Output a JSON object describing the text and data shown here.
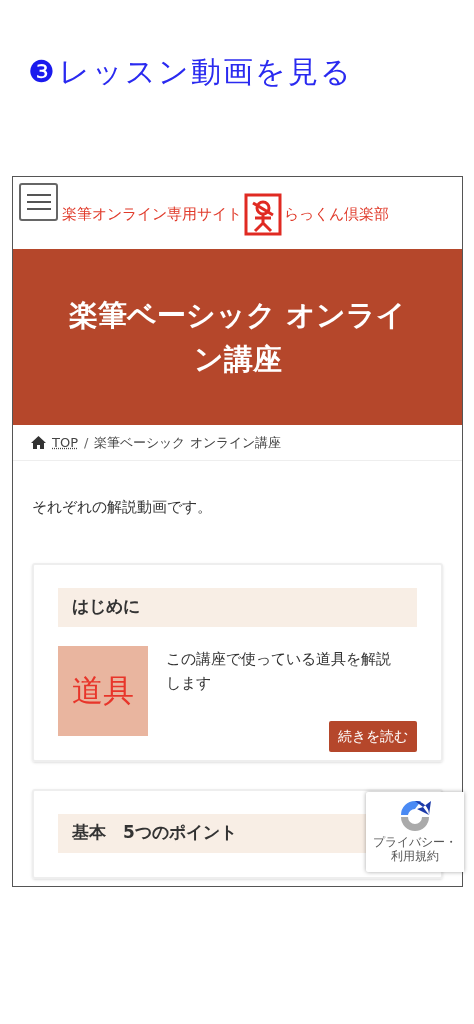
{
  "heading": {
    "number": "❸",
    "text": "レッスン動画を見る"
  },
  "site": {
    "name_left": "楽筆オンライン専用サイト",
    "name_right": "らっくん倶楽部"
  },
  "banner_title": "楽筆ベーシック オンライン講座",
  "breadcrumb": [
    {
      "label": "TOP",
      "kind": "link"
    },
    {
      "label": "楽筆ベーシック オンライン講座",
      "kind": "current"
    }
  ],
  "separator": "/",
  "intro": "それぞれの解説動画です。",
  "cards": [
    {
      "title": "はじめに",
      "thumbnail": "道具",
      "excerpt": "この講座で使っている道具を解説します",
      "button": "続きを読む"
    },
    {
      "title": "基本　5つのポイント"
    }
  ],
  "recaptcha": {
    "links": "プライバシー・利用規約"
  }
}
